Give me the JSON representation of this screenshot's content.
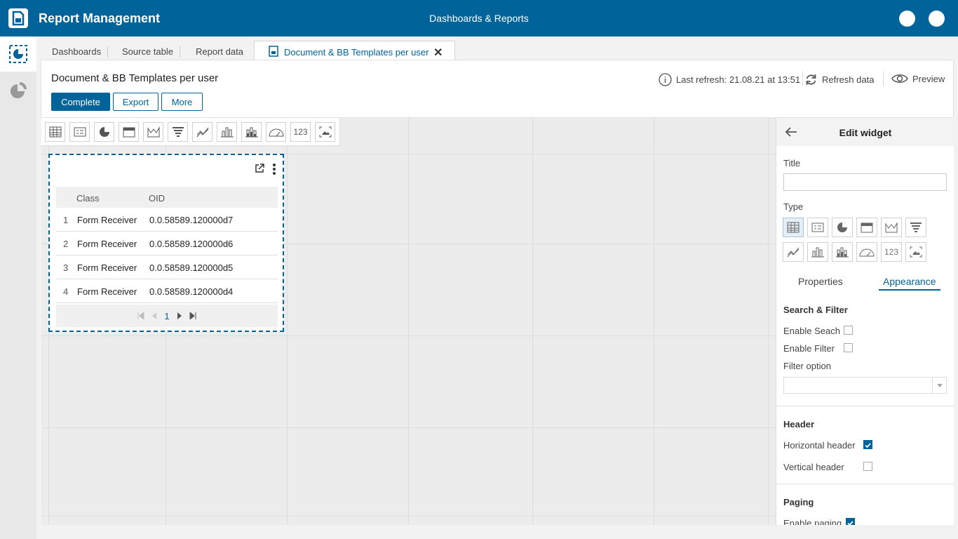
{
  "topbar": {
    "app_title": "Report Management",
    "center_title": "Dashboards & Reports"
  },
  "tabs": {
    "items": [
      "Dashboards",
      "Source table",
      "Report data"
    ],
    "active_label": "Document & BB Templates per user"
  },
  "header": {
    "page_title": "Document & BB Templates per user",
    "complete_label": "Complete",
    "export_label": "Export",
    "more_label": "More",
    "last_refresh": "Last refresh: 21.08.21 at 13:51",
    "refresh_label": "Refresh data",
    "preview_label": "Preview"
  },
  "toolbar": {
    "number_label": "123"
  },
  "widget": {
    "columns": [
      "Class",
      "OID"
    ],
    "rows": [
      {
        "n": "1",
        "class": "Form Receiver",
        "oid": "0.0.58589.120000d7"
      },
      {
        "n": "2",
        "class": "Form Receiver",
        "oid": "0.0.58589.120000d6"
      },
      {
        "n": "3",
        "class": "Form Receiver",
        "oid": "0.0.58589.120000d5"
      },
      {
        "n": "4",
        "class": "Form Receiver",
        "oid": "0.0.58589.120000d4"
      }
    ],
    "page": "1"
  },
  "panel": {
    "title": "Edit widget",
    "title_label": "Title",
    "title_value": "",
    "type_label": "Type",
    "number_label": "123",
    "tab_properties": "Properties",
    "tab_appearance": "Appearance",
    "search_filter_heading": "Search & Filter",
    "enable_search": "Enable Seach",
    "enable_filter": "Enable Filter",
    "filter_option": "Filter option",
    "header_heading": "Header",
    "horizontal_header": "Horizontal header",
    "vertical_header": "Vertical header",
    "paging_heading": "Paging",
    "enable_paging": "Enable paging"
  },
  "colors": {
    "brand": "#00639a",
    "canvas": "#ececec"
  }
}
